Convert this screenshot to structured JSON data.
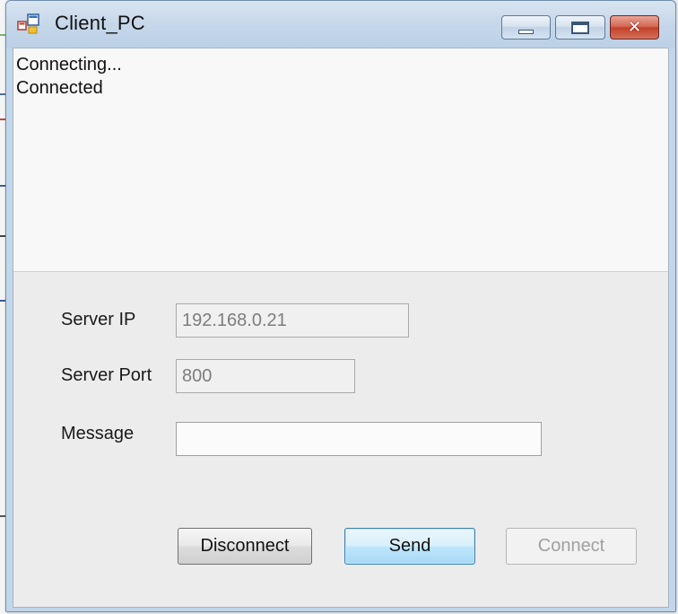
{
  "window": {
    "title": "Client_PC",
    "close_glyph": "✕"
  },
  "log": {
    "lines": [
      "Connecting...",
      "Connected"
    ]
  },
  "form": {
    "server_ip_label": "Server IP",
    "server_ip_value": "192.168.0.21",
    "server_port_label": "Server Port",
    "server_port_value": "800",
    "message_label": "Message",
    "message_value": ""
  },
  "buttons": {
    "disconnect": "Disconnect",
    "send": "Send",
    "connect": "Connect"
  },
  "icons": {
    "app": "app-windows-icon",
    "minimize": "minimize-icon",
    "maximize": "maximize-icon",
    "close": "close-icon"
  },
  "colors": {
    "default_button_border": "#3c7fb1",
    "close_button": "#c4412a",
    "disabled_text": "#a0a0a0"
  }
}
